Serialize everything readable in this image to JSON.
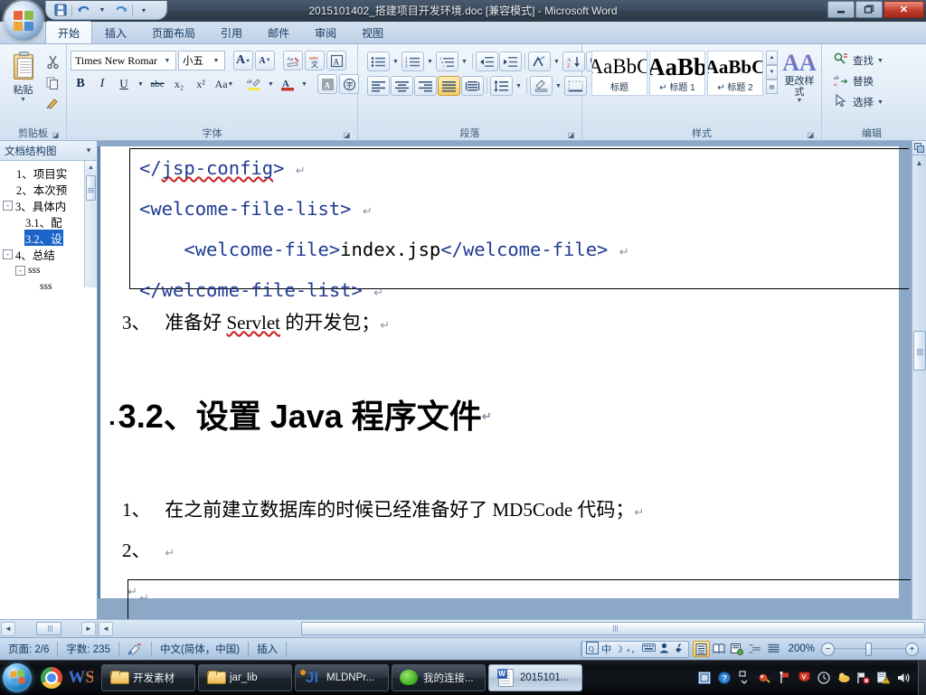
{
  "window": {
    "title": "2015101402_搭建项目开发环境.doc [兼容模式] - Microsoft Word",
    "minimize": "—",
    "restore": "❐",
    "close": "✕"
  },
  "quick_access": {
    "save_icon": "save-icon",
    "undo_icon": "undo-icon",
    "redo_icon": "redo-icon",
    "customize_icon": "customize-icon"
  },
  "ribbon": {
    "tabs": [
      {
        "label": "开始",
        "active": true
      },
      {
        "label": "插入",
        "active": false
      },
      {
        "label": "页面布局",
        "active": false
      },
      {
        "label": "引用",
        "active": false
      },
      {
        "label": "邮件",
        "active": false
      },
      {
        "label": "审阅",
        "active": false
      },
      {
        "label": "视图",
        "active": false
      }
    ],
    "groups": {
      "clipboard": {
        "label": "剪贴板",
        "paste_label": "粘贴",
        "cut_icon": "scissors-icon",
        "copy_icon": "copy-icon",
        "format_painter_icon": "paintbrush-icon"
      },
      "font": {
        "label": "字体",
        "font_name": "Times New Romar",
        "font_size": "小五",
        "grow_font": "A",
        "shrink_font": "A",
        "clear_formatting_icon": "clear-format-icon",
        "phonetic_icon": "phonetic-guide-icon",
        "char_border_icon": "character-border-icon",
        "bold": "B",
        "italic": "I",
        "underline": "U",
        "strikethrough": "abc",
        "subscript": "x₂",
        "superscript": "x²",
        "change_case": "Aa",
        "highlight_icon": "text-highlight-icon",
        "font_color_icon": "font-color-icon",
        "shading_icon": "character-shading-icon",
        "enclose_icon": "enclose-character-icon"
      },
      "paragraph": {
        "label": "段落",
        "bullets_icon": "bullet-list-icon",
        "numbering_icon": "numbered-list-icon",
        "multilevel_icon": "multilevel-list-icon",
        "decrease_indent_icon": "decrease-indent-icon",
        "increase_indent_icon": "increase-indent-icon",
        "cn_layout_icon": "asian-layout-icon",
        "sort_icon": "sort-icon",
        "show_marks_icon": "show-formatting-marks-icon",
        "align_left_icon": "align-left-icon",
        "align_center_icon": "align-center-icon",
        "align_right_icon": "align-right-icon",
        "align_justify_icon": "align-justify-icon",
        "distributed_icon": "distributed-align-icon",
        "line_spacing_icon": "line-spacing-icon",
        "shading_icon": "paragraph-shading-icon",
        "borders_icon": "borders-icon"
      },
      "styles": {
        "label": "样式",
        "gallery": [
          {
            "preview": "AaBbC",
            "name": "标题",
            "pilcrow": false,
            "selected": false
          },
          {
            "preview": "AaBb",
            "name": "标题 1",
            "pilcrow": true,
            "selected": false
          },
          {
            "preview": "AaBbC",
            "name": "标题 2",
            "pilcrow": true,
            "selected": false
          }
        ],
        "change_styles_label": "更改样式",
        "scroll_up": "▲",
        "scroll_down": "▼",
        "more": "▤"
      },
      "editing": {
        "label": "编辑",
        "items": [
          {
            "label": "查找",
            "icon": "find-icon",
            "has_arrow": true
          },
          {
            "label": "替换",
            "icon": "replace-icon",
            "has_arrow": false
          },
          {
            "label": "选择",
            "icon": "select-icon",
            "has_arrow": true
          }
        ]
      }
    }
  },
  "document_map": {
    "title": "文档结构图",
    "close": "✕",
    "items": [
      {
        "label": "1、项目实",
        "indent": 1,
        "expander": "",
        "selected": false
      },
      {
        "label": "2、本次预",
        "indent": 1,
        "expander": "",
        "selected": false
      },
      {
        "label": "3、具体内",
        "indent": 0,
        "expander": "-",
        "selected": false
      },
      {
        "label": "3.1、配",
        "indent": 1,
        "expander": "",
        "selected": false
      },
      {
        "label": "3.2、设",
        "indent": 1,
        "expander": "",
        "selected": true
      },
      {
        "label": "4、总结",
        "indent": 0,
        "expander": "-",
        "selected": false
      },
      {
        "label": "sss",
        "indent": 1,
        "expander": "-",
        "selected": false
      },
      {
        "label": "sss",
        "indent": 2,
        "expander": "",
        "selected": false
      }
    ]
  },
  "document": {
    "code_lines": [
      {
        "segments": [
          {
            "text": "</",
            "style": "code"
          },
          {
            "text": "jsp-config",
            "style": "code-squiggle"
          },
          {
            "text": ">",
            "style": "code"
          }
        ],
        "mark": "↵"
      },
      {
        "segments": [
          {
            "text": "<welcome-file-list>",
            "style": "code"
          }
        ],
        "mark": "↵"
      },
      {
        "segments": [
          {
            "text": "    ",
            "style": "code"
          },
          {
            "text": "<welcome-file>",
            "style": "code"
          },
          {
            "text": "index.jsp",
            "style": "plain"
          },
          {
            "text": "</welcome-file>",
            "style": "code"
          }
        ],
        "mark": "↵"
      },
      {
        "segments": [
          {
            "text": "</welcome-file-list>",
            "style": "code"
          }
        ],
        "mark": "↵"
      }
    ],
    "list_item_3": {
      "number": "3、",
      "text": "   准备好 Servlet 的开发包；",
      "mark": "↵"
    },
    "heading": {
      "bullet": "▪",
      "text": "3.2、设置 Java 程序文件",
      "mark": "↵"
    },
    "list_item_1": {
      "number": "1、",
      "text": "   在之前建立数据库的时候已经准备好了 MD5Code 代码；",
      "mark": "↵"
    },
    "list_item_2": {
      "number": "2、",
      "text": "   ",
      "mark": "↵"
    },
    "empty_mark": "↵",
    "textbox_mark": "↵"
  },
  "status_bar": {
    "page": "页面: 2/6",
    "word_count": "字数: 235",
    "proofing_icon": "proofing-errors-icon",
    "language": "中文(简体，中国)",
    "insert_mode": "插入",
    "zoom": "200%",
    "zoom_out": "−",
    "zoom_in": "+",
    "view_buttons": [
      {
        "icon": "print-layout-icon",
        "active": true
      },
      {
        "icon": "full-screen-reading-icon",
        "active": false
      },
      {
        "icon": "web-layout-icon",
        "active": false
      },
      {
        "icon": "outline-icon",
        "active": false
      },
      {
        "icon": "draft-icon",
        "active": false
      }
    ],
    "ime": {
      "logo_icon": "ime-logo-icon",
      "mode": "中",
      "shape_icon": "half-width-icon",
      "punctuation_icon": "punctuation-icon",
      "keyboard_icon": "soft-keyboard-icon",
      "user_icon": "ime-user-icon",
      "tools_icon": "ime-tools-icon"
    }
  },
  "scrollbars": {
    "h_left_arrow": "◄",
    "h_right_arrow": "►",
    "v_up_arrow": "▲",
    "v_down_arrow": "▼",
    "split_icon": "split-window-icon"
  },
  "taskbar": {
    "start_label": "start-orb",
    "quick_launch": [
      {
        "icon": "chrome-icon",
        "name": "chrome"
      },
      {
        "icon": "webstorm-icon",
        "name": "webstorm",
        "glyph": "WS"
      }
    ],
    "tasks": [
      {
        "label": "开发素材",
        "icon": "folder-icon",
        "active": false
      },
      {
        "label": "jar_lib",
        "icon": "folder-icon",
        "active": false
      },
      {
        "label": "MLDNPr...",
        "icon": "mldn-icon",
        "active": false
      },
      {
        "label": "我的连接...",
        "icon": "green-app-icon",
        "active": false
      },
      {
        "label": "2015101...",
        "icon": "word-doc-icon",
        "active": true
      }
    ],
    "tray": [
      {
        "icon": "window-manager-icon",
        "glyph": "▣"
      },
      {
        "icon": "help-icon",
        "glyph": "?"
      },
      {
        "icon": "show-hidden-icons-icon",
        "glyph": "⎘"
      },
      {
        "icon": "antivirus-icon",
        "glyph": "◉"
      },
      {
        "icon": "flag-pin-icon",
        "glyph": "⚑"
      },
      {
        "icon": "shield-icon",
        "glyph": "V"
      },
      {
        "icon": "clock-icon",
        "glyph": "◷"
      },
      {
        "icon": "messenger-icon",
        "glyph": "☁"
      },
      {
        "icon": "network-error-icon",
        "glyph": "⚠"
      },
      {
        "icon": "action-center-icon",
        "glyph": "⚠"
      },
      {
        "icon": "volume-icon",
        "glyph": "🔊"
      }
    ]
  },
  "colors": {
    "titlebar": "#32414f",
    "ribbon": "#d2e0f0",
    "accent_blue": "#15375f",
    "code_text": "#1f3a93",
    "selection": "#1b64c8",
    "close_red": "#c0392b",
    "taskbar": "#0b0e12"
  }
}
